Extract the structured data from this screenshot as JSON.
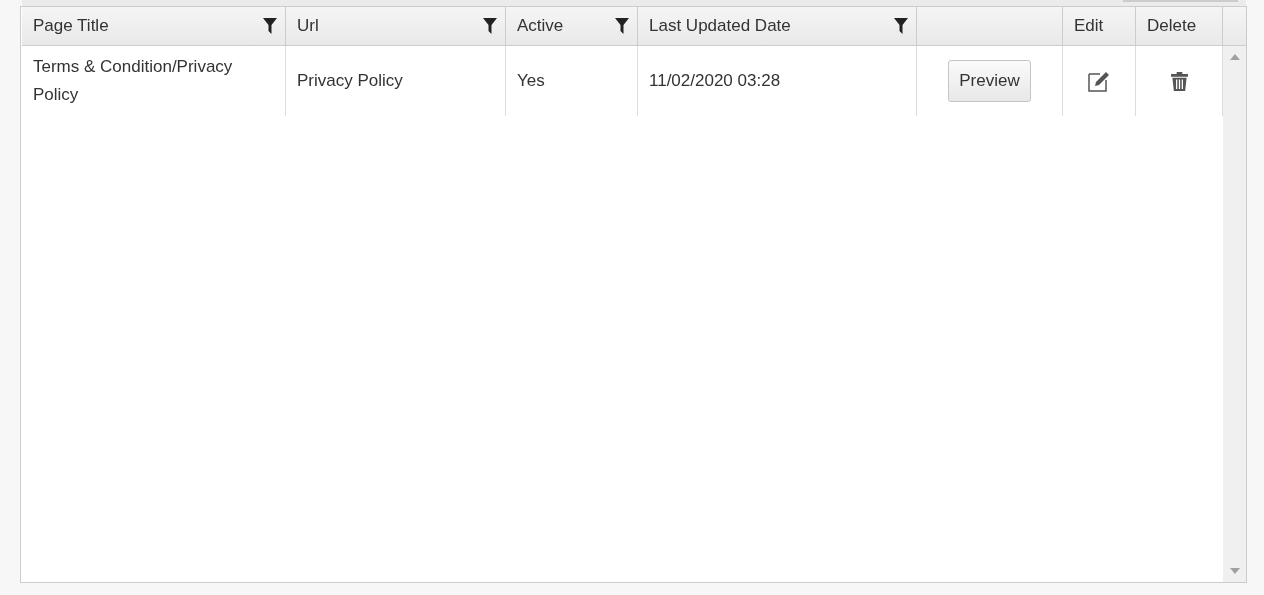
{
  "table": {
    "columns": [
      {
        "label": "Page Title",
        "filter": true
      },
      {
        "label": "Url",
        "filter": true
      },
      {
        "label": "Active",
        "filter": true
      },
      {
        "label": "Last Updated Date",
        "filter": true
      },
      {
        "filter": false
      },
      {
        "label": "Edit",
        "filter": false
      },
      {
        "label": "Delete",
        "filter": false
      }
    ],
    "rows": [
      {
        "cells": [
          {
            "kind": "text",
            "text": "Terms & Condition/Privacy Policy"
          },
          {
            "kind": "text",
            "text": "Privacy Policy"
          },
          {
            "kind": "text",
            "text": "Yes"
          },
          {
            "kind": "text",
            "text": "11/02/2020 03:28"
          },
          {
            "kind": "button",
            "text": "Preview"
          },
          {
            "kind": "edit"
          },
          {
            "kind": "delete"
          }
        ]
      }
    ]
  }
}
